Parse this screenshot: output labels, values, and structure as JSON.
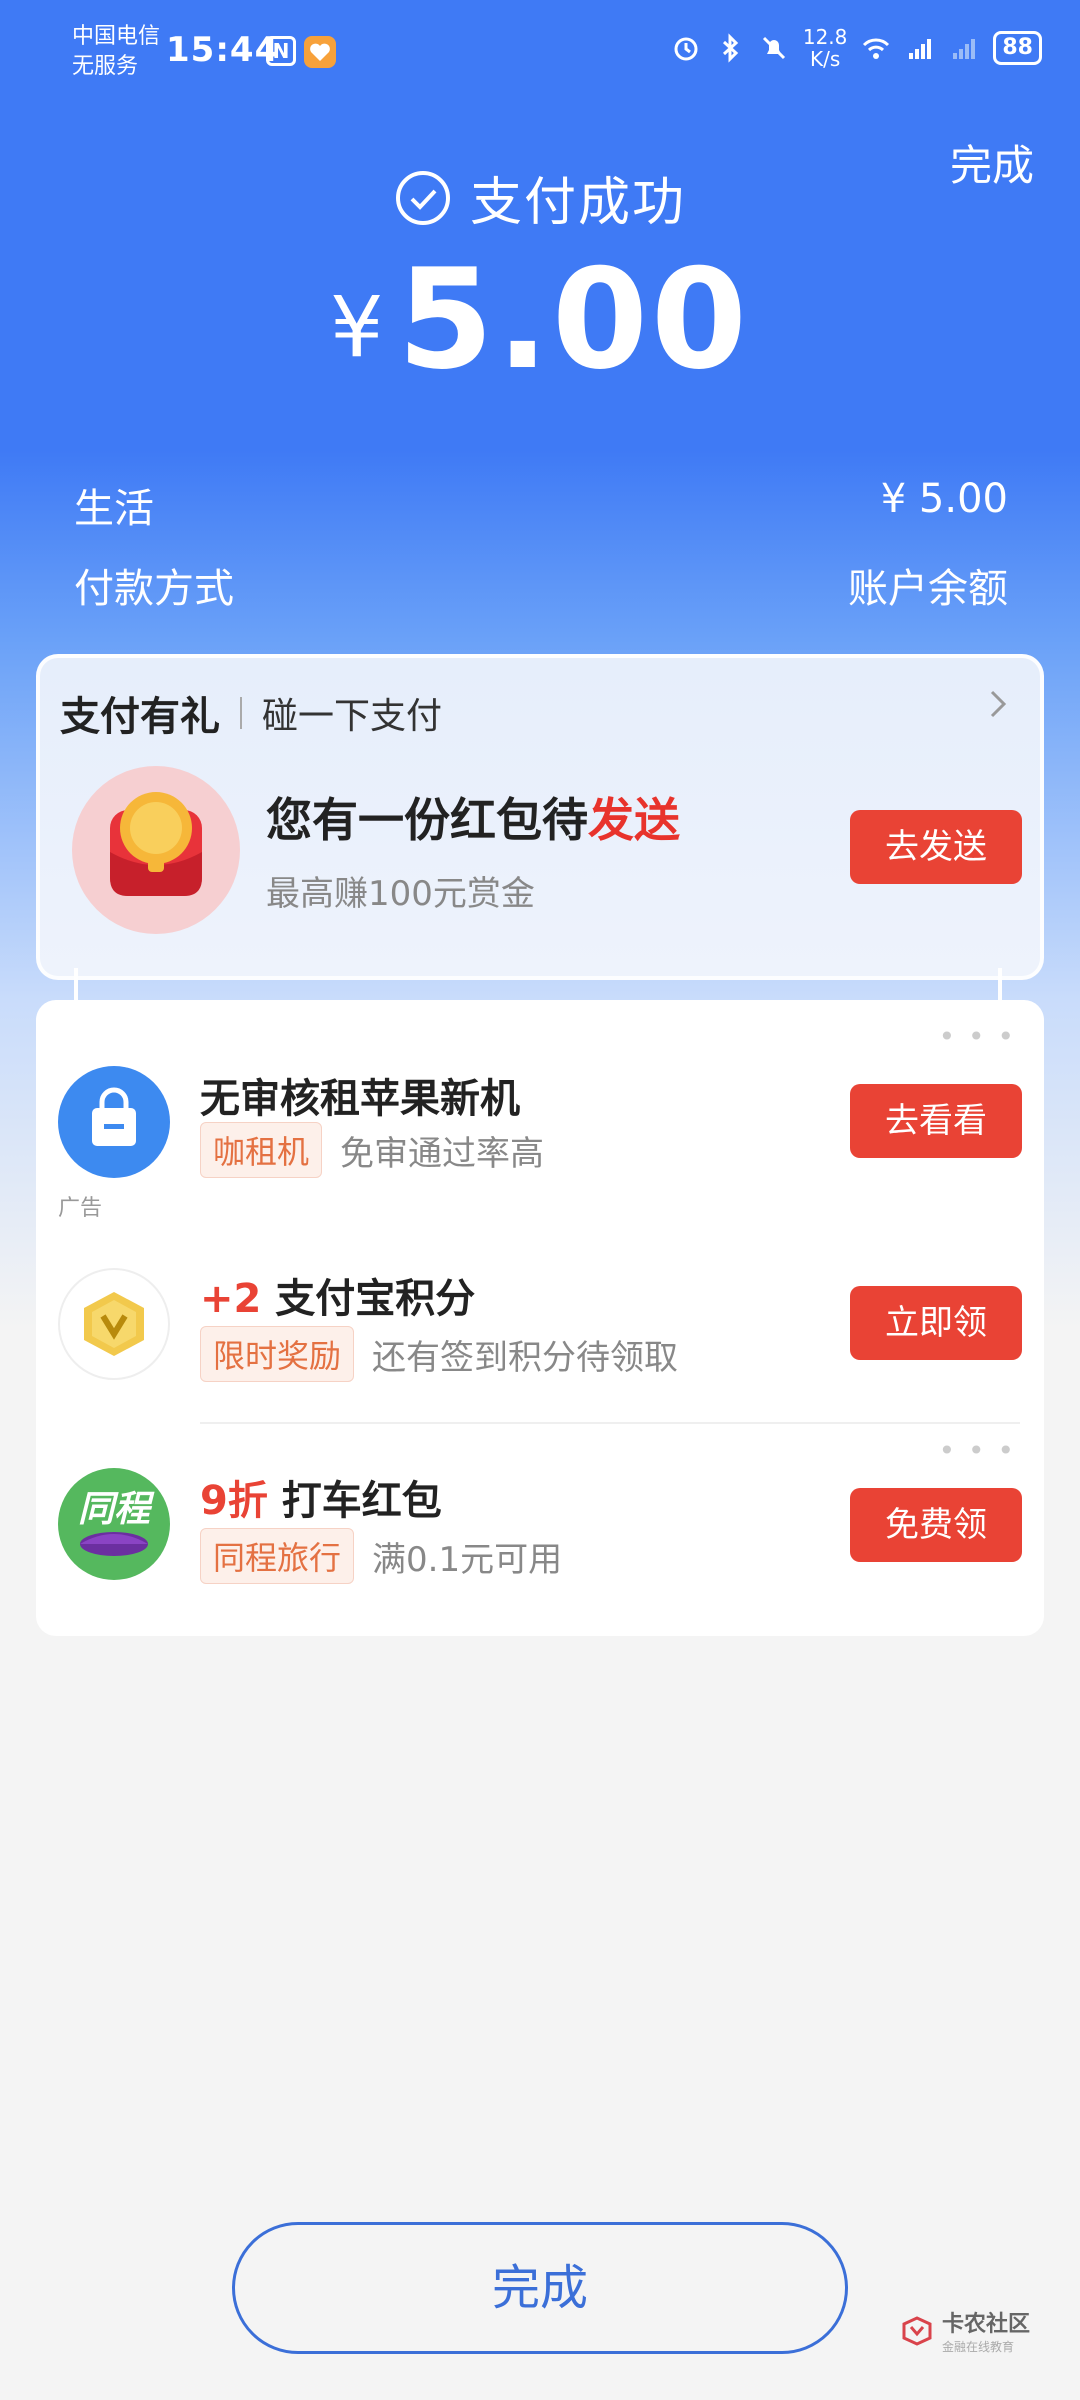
{
  "status_bar": {
    "carrier_line1": "中国电信",
    "carrier_line2": "无服务",
    "time": "15:44",
    "nfc_label": "N",
    "net_speed_value": "12.8",
    "net_speed_unit": "K/s",
    "battery": "88"
  },
  "header": {
    "done_label": "完成",
    "success_text": "支付成功",
    "currency_symbol": "¥",
    "amount": "5.00"
  },
  "details": {
    "category_label": "生活",
    "category_amount": "¥ 5.00",
    "payment_method_label": "付款方式",
    "payment_method_value": "账户余额"
  },
  "promo": {
    "brand": "支付有礼",
    "subtitle": "碰一下支付",
    "title_prefix": "您有一份红包待",
    "title_highlight": "发送",
    "description": "最高赚100元赏金",
    "button_label": "去发送"
  },
  "offers": [
    {
      "title": "无审核租苹果新机",
      "tag": "咖租机",
      "subtitle": "免审通过率高",
      "button_label": "去看看",
      "ad_label": "广告"
    },
    {
      "title_number": "+2",
      "title": "支付宝积分",
      "tag": "限时奖励",
      "subtitle": "还有签到积分待领取",
      "button_label": "立即领"
    },
    {
      "title_number": "9折",
      "title": "打车红包",
      "icon_text": "同程",
      "tag": "同程旅行",
      "subtitle": "满0.1元可用",
      "button_label": "免费领"
    }
  ],
  "bottom": {
    "done_button_label": "完成"
  },
  "watermark": {
    "main": "卡农社区",
    "sub": "金融在线教育"
  },
  "colors": {
    "header_blue": "#3f7af5",
    "button_red": "#e94335",
    "highlight_red": "#e8332c",
    "tag_orange": "#e47142",
    "done_border_blue": "#3b6fd8"
  }
}
